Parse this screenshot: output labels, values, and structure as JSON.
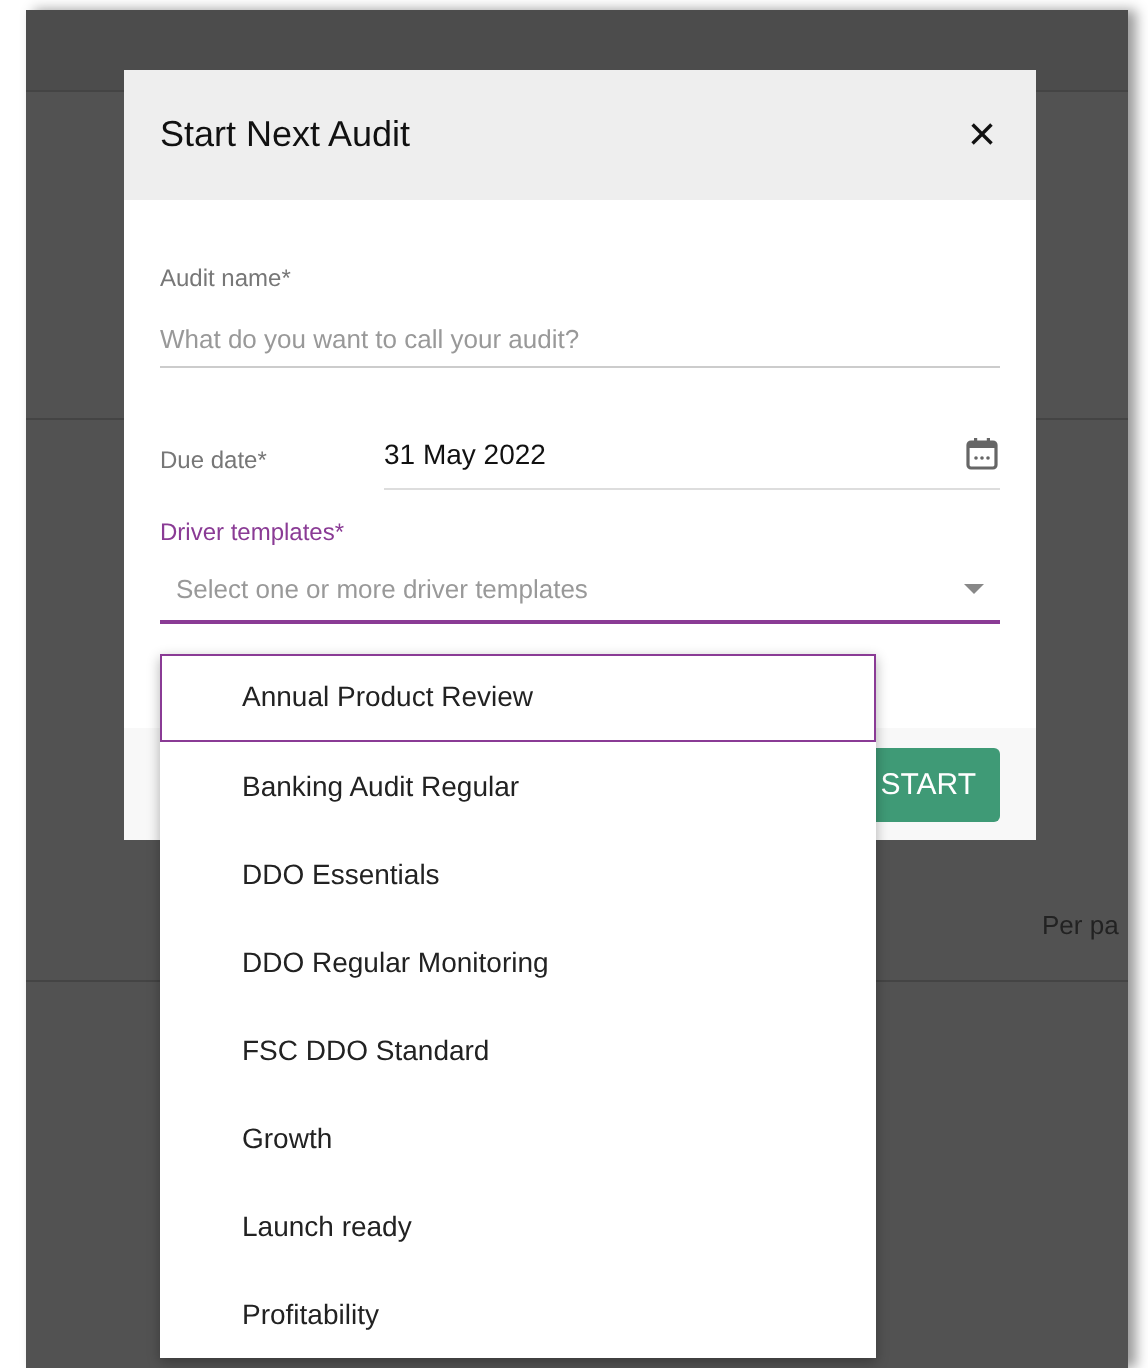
{
  "background": {
    "pagination_label": "Per pa"
  },
  "dialog": {
    "title": "Start Next Audit",
    "close": "×",
    "fields": [
      {
        "kind": "text",
        "label": "Audit name*",
        "placeholder": "What do you want to call your audit?"
      },
      {
        "kind": "date",
        "label": "Due date*",
        "value": "31 May 2022"
      },
      {
        "kind": "select",
        "label": "Driver templates*",
        "placeholder": "Select one or more driver templates",
        "expanded": true
      }
    ],
    "primary_button": "START"
  },
  "dropdown": {
    "options": [
      {
        "label": "Annual Product Review",
        "selected": true
      },
      {
        "label": "Banking Audit Regular",
        "selected": false
      },
      {
        "label": "DDO Essentials",
        "selected": false
      },
      {
        "label": "DDO Regular Monitoring",
        "selected": false
      },
      {
        "label": "FSC DDO Standard",
        "selected": false
      },
      {
        "label": "Growth",
        "selected": false
      },
      {
        "label": "Launch ready",
        "selected": false
      },
      {
        "label": "Profitability",
        "selected": false
      }
    ]
  }
}
